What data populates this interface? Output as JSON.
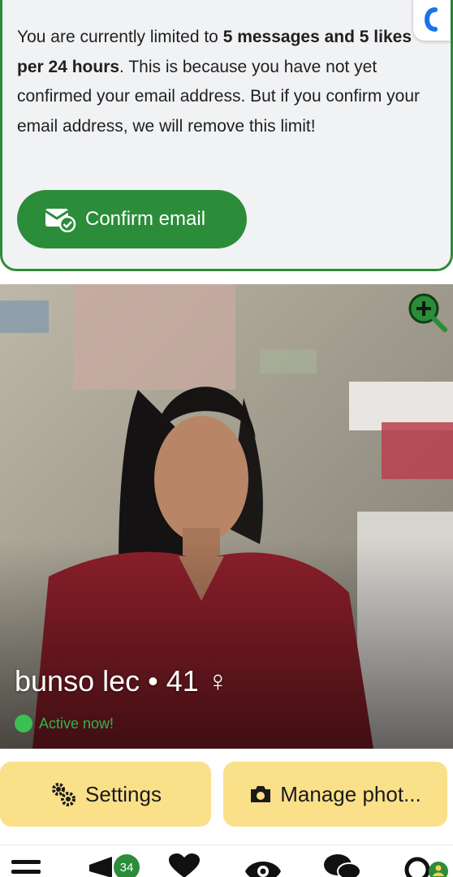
{
  "banner": {
    "text_part1": "You are currently limited to ",
    "text_bold": "5 messages and 5 likes per 24 hours",
    "text_part2": ". This is because you have not yet confirmed your email address. But if you confirm your email address, we will remove this limit!",
    "confirm_label": "Confirm email"
  },
  "profile": {
    "name": "bunso lec",
    "separator": "•",
    "age": "41",
    "gender_symbol": "♀",
    "status": "Active now!"
  },
  "actions": {
    "settings_label": "Settings",
    "manage_label": "Manage phot..."
  },
  "nav": {
    "badge_count": "34"
  },
  "colors": {
    "accent_green": "#2b8c39",
    "button_yellow": "#fbe08a",
    "active_green": "#34b34a"
  }
}
